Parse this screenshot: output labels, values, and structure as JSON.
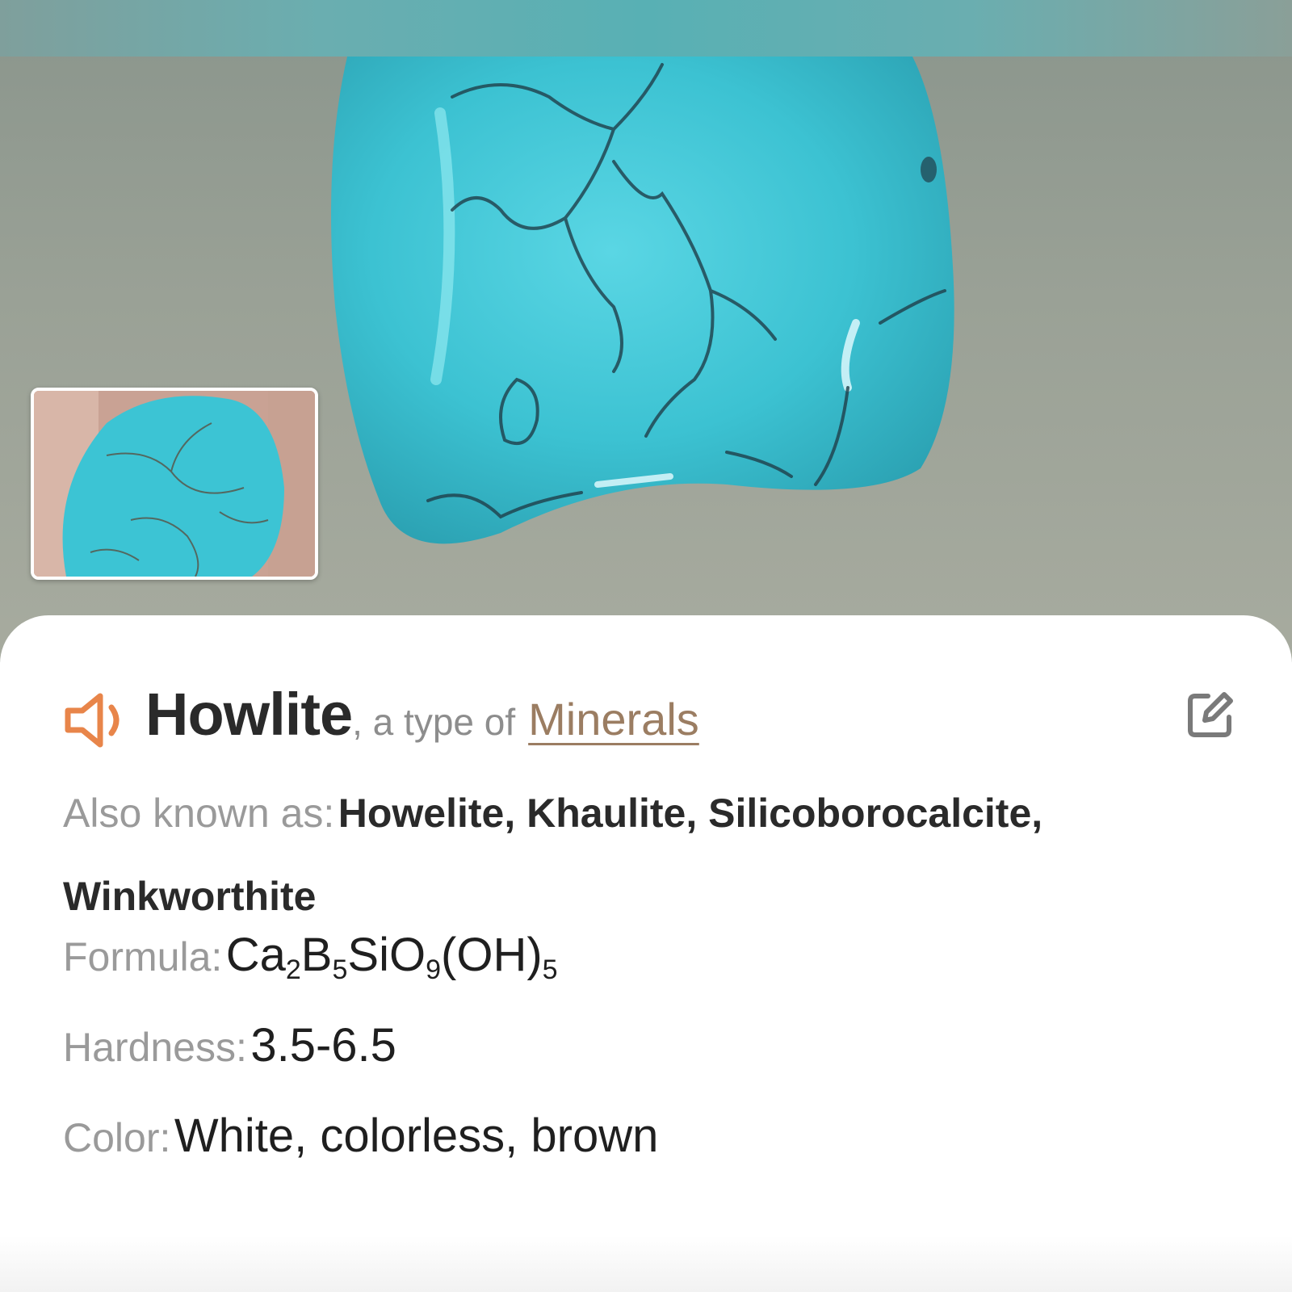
{
  "mineral": {
    "name": "Howlite",
    "type_prefix": ", a type of",
    "category_link": "Minerals"
  },
  "details": {
    "also_known_as": {
      "label": "Also known as:",
      "value": "Howelite, Khaulite, Silicoborocalcite, Winkworthite"
    },
    "formula": {
      "label": "Formula:",
      "parts": [
        {
          "text": "Ca",
          "sub": "2"
        },
        {
          "text": "B",
          "sub": "5"
        },
        {
          "text": "SiO",
          "sub": "9"
        },
        {
          "text": "(OH)",
          "sub": "5"
        }
      ]
    },
    "hardness": {
      "label": "Hardness:",
      "value": "3.5-6.5"
    },
    "color": {
      "label": "Color:",
      "value": "White, colorless, brown"
    }
  },
  "icons": {
    "speaker": "speaker-icon",
    "edit": "edit-icon"
  },
  "colors": {
    "accent_orange": "#e8854a",
    "link_brown": "#9b7d62",
    "stone_turquoise": "#3cc4d4"
  }
}
